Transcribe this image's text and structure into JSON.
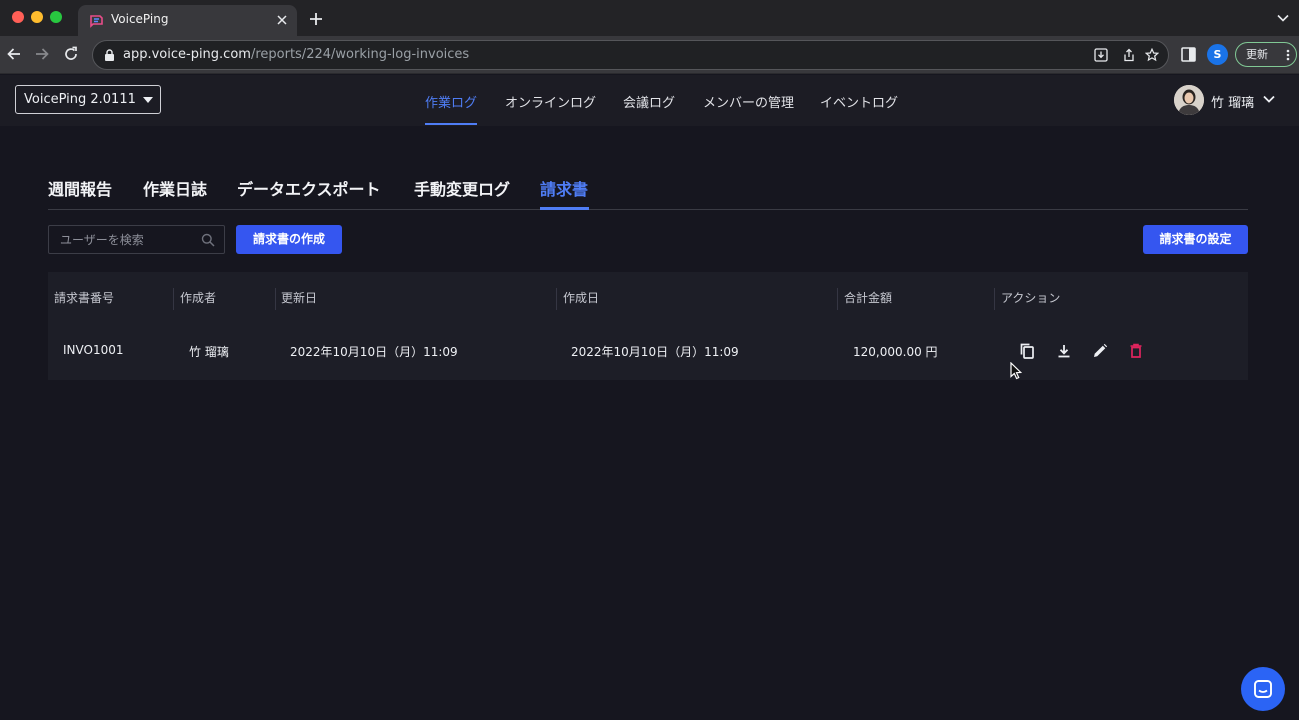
{
  "browser": {
    "tab_title": "VoicePing",
    "url_host": "app.voice-ping.com",
    "url_path": "/reports/224/working-log-invoices",
    "profile_initial": "S",
    "update_label": "更新"
  },
  "header": {
    "workspace": "VoicePing 2.0111",
    "nav": [
      {
        "label": "作業ログ",
        "active": true
      },
      {
        "label": "オンラインログ",
        "active": false
      },
      {
        "label": "会議ログ",
        "active": false
      },
      {
        "label": "メンバーの管理",
        "active": false
      },
      {
        "label": "イベントログ",
        "active": false
      }
    ],
    "user_name": "竹 瑠璃"
  },
  "subtabs": [
    {
      "label": "週間報告",
      "active": false
    },
    {
      "label": "作業日誌",
      "active": false
    },
    {
      "label": "データエクスポート",
      "active": false
    },
    {
      "label": "手動変更ログ",
      "active": false
    },
    {
      "label": "請求書",
      "active": true
    }
  ],
  "controls": {
    "search_placeholder": "ユーザーを検索",
    "create_label": "請求書の作成",
    "settings_label": "請求書の設定"
  },
  "table": {
    "columns": [
      "請求書番号",
      "作成者",
      "更新日",
      "作成日",
      "合計金額",
      "アクション"
    ],
    "rows": [
      {
        "invoice_no": "INVO1001",
        "author": "竹 瑠璃",
        "updated": "2022年10月10日（月）11:09",
        "created": "2022年10月10日（月）11:09",
        "total": "120,000.00 円"
      }
    ],
    "actions": [
      "copy-icon",
      "download-icon",
      "edit-icon",
      "delete-icon"
    ]
  },
  "colors": {
    "accent": "#4f7df5",
    "primary_button": "#3556f0",
    "danger": "#e0245e",
    "background": "#16161f"
  }
}
